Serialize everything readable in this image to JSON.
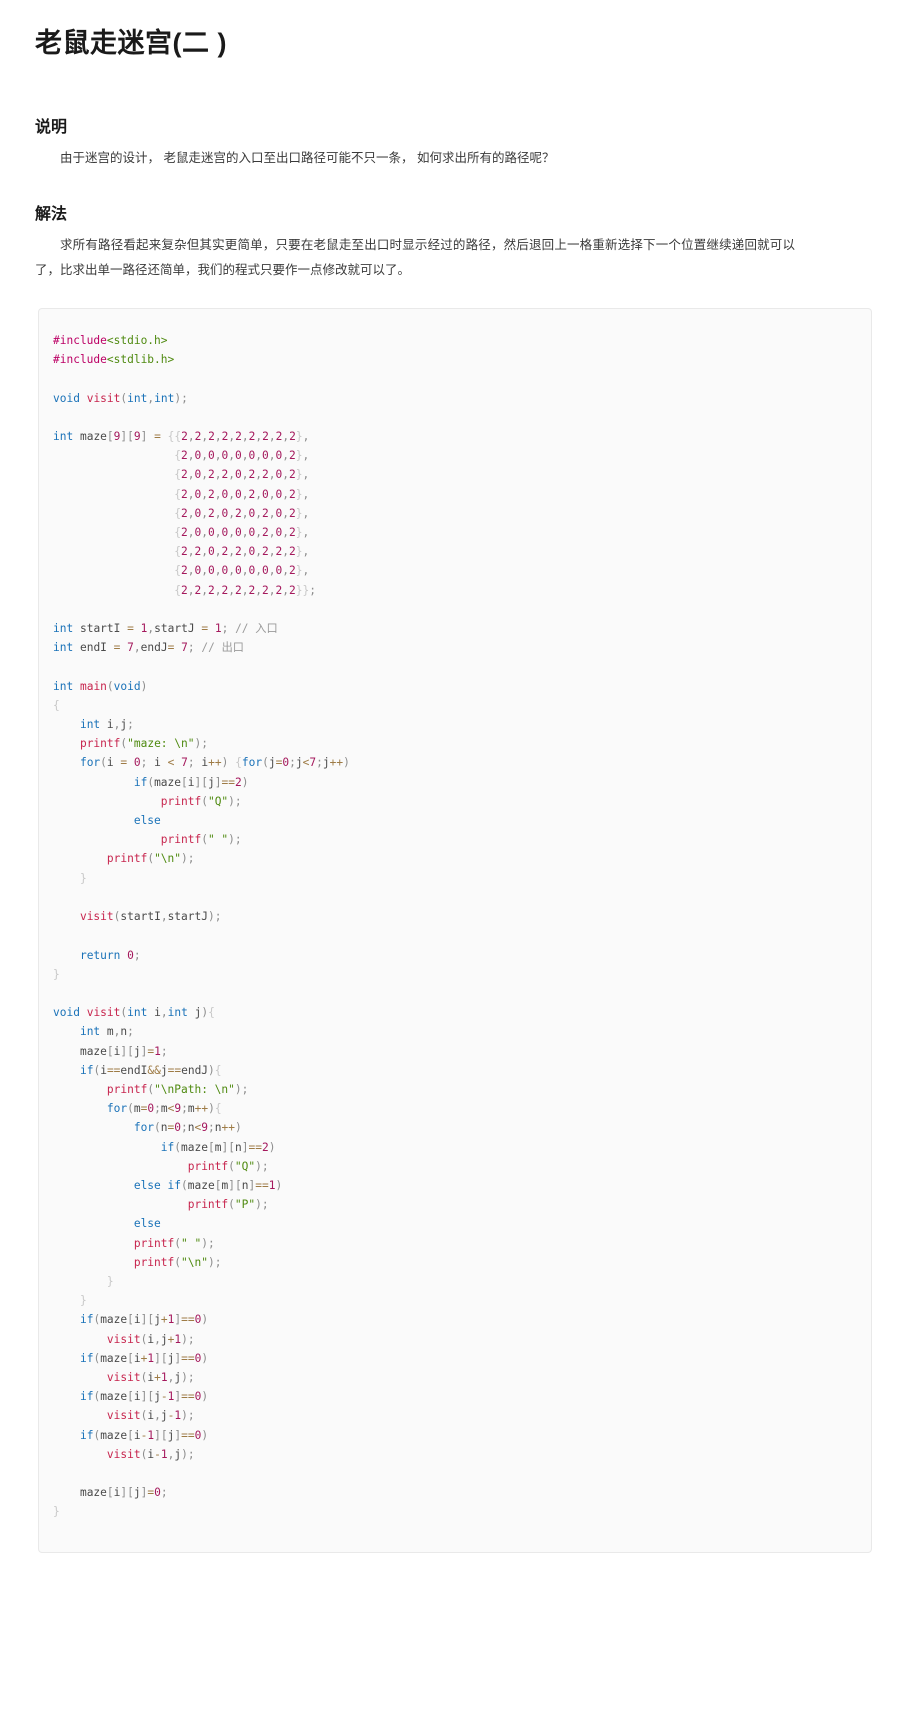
{
  "page": {
    "title": "老鼠走迷宫(二 )"
  },
  "sections": [
    {
      "heading": "说明",
      "paragraph": "由于迷宫的设计， 老鼠走迷宫的入口至出口路径可能不只一条， 如何求出所有的路径呢？"
    },
    {
      "heading": "解法",
      "paragraph": "求所有路径看起来复杂但其实更简单，只要在老鼠走至出口时显示经过的路径，然后退回上一格重新选择下一个位置继续递回就可以了，比求出单一路径还简单，我们的程式只要作一点修改就可以了。"
    }
  ],
  "code_block": {
    "language": "c",
    "colors": {
      "background": "#fafafa",
      "border": "#e9e9e9",
      "preprocessor": "#bc0065",
      "string": "#4f8a10",
      "keyword": "#1a72b8",
      "function": "#c7254e",
      "number": "#a4185c",
      "punctuation": "#8d8d8d",
      "brace": "#c9c9c9",
      "comment": "#9a9a9a",
      "operator": "#9e7b45"
    },
    "source": "#include<stdio.h>\n#include<stdlib.h>\n\nvoid visit(int,int);\n\nint maze[9][9] = {{2,2,2,2,2,2,2,2,2},\n                  {2,0,0,0,0,0,0,0,2},\n                  {2,0,2,2,0,2,2,0,2},\n                  {2,0,2,0,0,2,0,0,2},\n                  {2,0,2,0,2,0,2,0,2},\n                  {2,0,0,0,0,0,2,0,2},\n                  {2,2,0,2,2,0,2,2,2},\n                  {2,0,0,0,0,0,0,0,2},\n                  {2,2,2,2,2,2,2,2,2}};\n\nint startI = 1,startJ = 1; // 入口\nint endI = 7,endJ= 7; // 出口\n\nint main(void)\n{\n    int i,j;\n    printf(\"maze: \\n\");\n    for(i = 0; i < 7; i++) {for(j=0;j<7;j++)\n            if(maze[i][j]==2)\n                printf(\"Q\");\n            else\n                printf(\" \");\n        printf(\"\\n\");\n    }\n\n    visit(startI,startJ);\n\n    return 0;\n}\n\nvoid visit(int i,int j){\n    int m,n;\n    maze[i][j]=1;\n    if(i==endI&&j==endJ){\n        printf(\"\\nPath: \\n\");\n        for(m=0;m<9;m++){\n            for(n=0;n<9;n++)\n                if(maze[m][n]==2)\n                    printf(\"Q\");\n            else if(maze[m][n]==1)\n                    printf(\"P\");\n            else\n            printf(\" \");\n            printf(\"\\n\");\n        }\n    }\n    if(maze[i][j+1]==0)\n        visit(i,j+1);\n    if(maze[i+1][j]==0)\n        visit(i+1,j);\n    if(maze[i][j-1]==0)\n        visit(i,j-1);\n    if(maze[i-1][j]==0)\n        visit(i-1,j);\n\n    maze[i][j]=0;\n}"
  }
}
